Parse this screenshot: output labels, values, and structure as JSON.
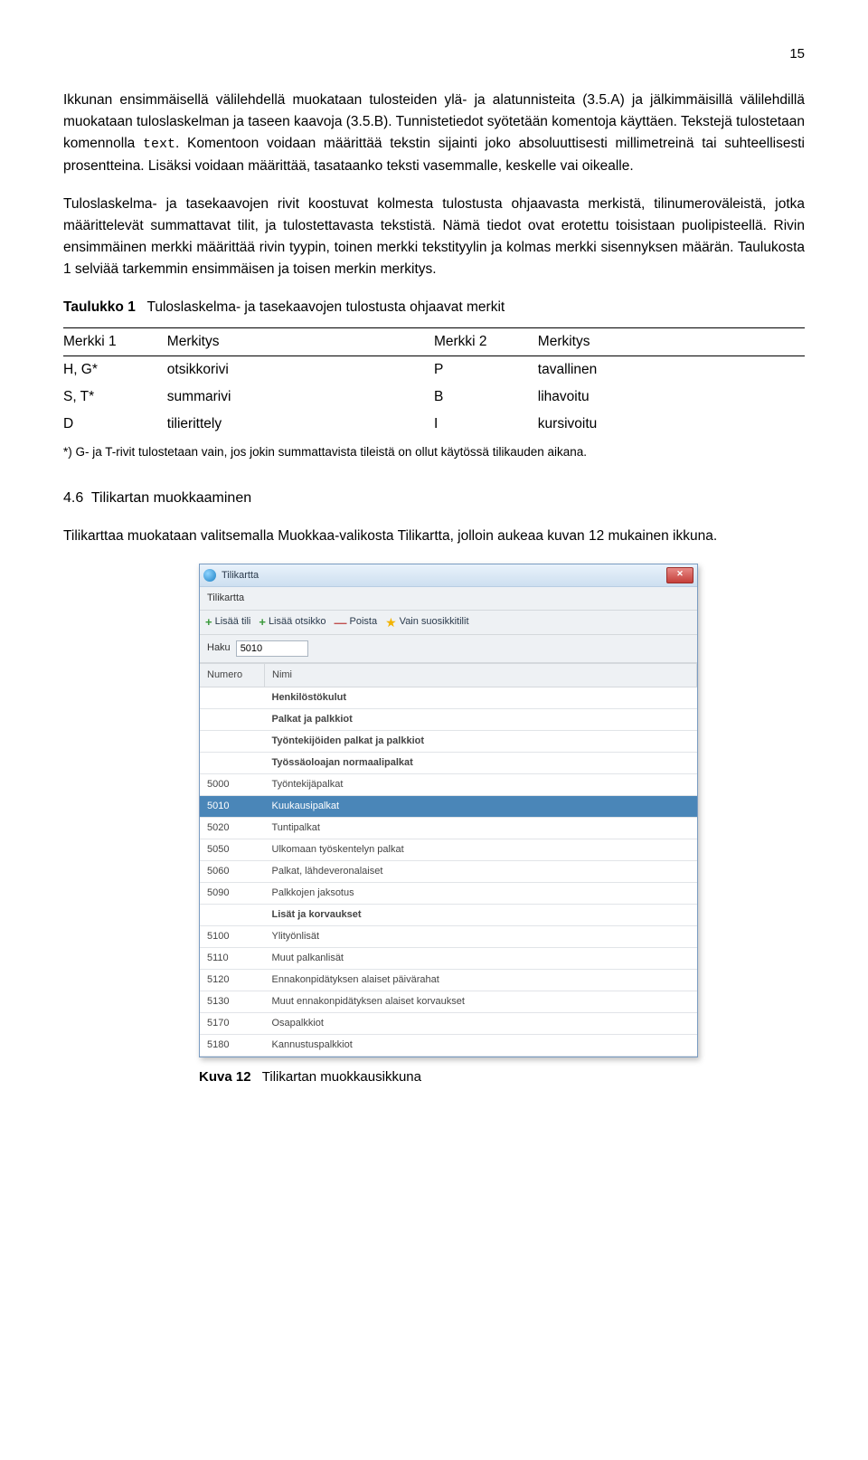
{
  "page_number": "15",
  "para1_a": "Ikkunan ensimmäisellä välilehdellä muokataan tulosteiden ylä- ja alatunnisteita (3.5.A) ja jälkimmäisillä välilehdillä muokataan tuloslaskelman ja taseen kaavoja (3.5.B). Tunnistetiedot syötetään komentoja käyttäen. Tekstejä tulostetaan komennolla ",
  "para1_code": "text",
  "para1_b": ". Komentoon voidaan määrittää tekstin sijainti joko absoluuttisesti millimetreinä tai suhteellisesti prosentteina. Lisäksi voidaan määrittää, tasataanko teksti vasemmalle, keskelle vai oikealle.",
  "para2": "Tuloslaskelma- ja tasekaavojen rivit koostuvat kolmesta tulostusta ohjaavasta merkistä, tilinumeroväleistä, jotka määrittelevät summattavat tilit, ja tulostettavasta tekstistä. Nämä tiedot ovat erotettu toisistaan puolipisteellä. Rivin ensimmäinen merkki määrittää rivin tyypin, toinen merkki tekstityylin ja kolmas merkki sisennyksen määrän. Taulukosta 1 selviää tarkemmin ensimmäisen ja toisen merkin merkitys.",
  "table1": {
    "caption_label": "Taulukko 1",
    "caption_text": "Tuloslaskelma- ja tasekaavojen tulostusta ohjaavat merkit",
    "h1": "Merkki 1",
    "h2": "Merkitys",
    "h3": "Merkki 2",
    "h4": "Merkitys",
    "rows": [
      {
        "c1": "H, G*",
        "c2": "otsikkorivi",
        "c3": "P",
        "c4": "tavallinen"
      },
      {
        "c1": "S, T*",
        "c2": "summarivi",
        "c3": "B",
        "c4": "lihavoitu"
      },
      {
        "c1": "D",
        "c2": "tilierittely",
        "c3": "I",
        "c4": "kursivoitu"
      }
    ]
  },
  "footnote": "*) G- ja T-rivit tulostetaan vain, jos jokin summattavista tileistä on ollut käytössä tilikauden aikana.",
  "section_number": "4.6",
  "section_title": "Tilikartan muokkaaminen",
  "para3": "Tilikarttaa muokataan valitsemalla Muokkaa-valikosta Tilikartta, jolloin aukeaa kuvan 12 mukainen ikkuna.",
  "win": {
    "title": "Tilikartta",
    "menu": "Tilikartta",
    "tb_add_account": "Lisää tili",
    "tb_add_heading": "Lisää otsikko",
    "tb_delete": "Poista",
    "tb_fav": "Vain suosikkitilit",
    "search_label": "Haku",
    "search_value": "5010",
    "col1": "Numero",
    "col2": "Nimi",
    "rows": [
      {
        "num": "",
        "name": "Henkilöstökulut",
        "heading": true,
        "indent": 1
      },
      {
        "num": "",
        "name": "Palkat ja palkkiot",
        "heading": true,
        "indent": 2
      },
      {
        "num": "",
        "name": "Työntekijöiden palkat ja palkkiot",
        "heading": true,
        "indent": 3
      },
      {
        "num": "",
        "name": "Työssäoloajan normaalipalkat",
        "heading": true,
        "indent": 4
      },
      {
        "num": "5000",
        "name": "Työntekijäpalkat",
        "indent": 5
      },
      {
        "num": "5010",
        "name": "Kuukausipalkat",
        "indent": 5,
        "selected": true
      },
      {
        "num": "5020",
        "name": "Tuntipalkat",
        "indent": 5
      },
      {
        "num": "5050",
        "name": "Ulkomaan työskentelyn palkat",
        "indent": 5
      },
      {
        "num": "5060",
        "name": "Palkat, lähdeveronalaiset",
        "indent": 5
      },
      {
        "num": "5090",
        "name": "Palkkojen jaksotus",
        "indent": 5
      },
      {
        "num": "",
        "name": "Lisät ja korvaukset",
        "heading": true,
        "indent": 4
      },
      {
        "num": "5100",
        "name": "Ylityönlisät",
        "indent": 5
      },
      {
        "num": "5110",
        "name": "Muut palkanlisät",
        "indent": 5
      },
      {
        "num": "5120",
        "name": "Ennakonpidätyksen alaiset päivärahat",
        "indent": 5
      },
      {
        "num": "5130",
        "name": "Muut ennakonpidätyksen alaiset korvaukset",
        "indent": 5
      },
      {
        "num": "5170",
        "name": "Osapalkkiot",
        "indent": 5
      },
      {
        "num": "5180",
        "name": "Kannustuspalkkiot",
        "indent": 5
      }
    ]
  },
  "fig": {
    "label": "Kuva 12",
    "text": "Tilikartan muokkausikkuna"
  }
}
